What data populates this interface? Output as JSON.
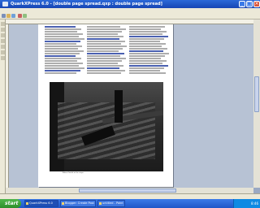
{
  "window": {
    "title": "QuarkXPress 6.0 - [double page spread.qxp : double page spread]"
  },
  "page": {
    "body_text_color": "#4a4a4a",
    "question_text_color": "#1e3a9e",
    "caption": "Robert Smith at the steps"
  },
  "taskbar": {
    "start_label": "start",
    "items": [
      {
        "label": "QuarkXPress 6.0"
      },
      {
        "label": "Blogger: Create Post"
      },
      {
        "label": "untitled - Paint"
      }
    ],
    "clock": "8:46"
  },
  "icons": [
    "app-icon",
    "minimize-icon",
    "maximize-icon",
    "close-icon",
    "start-icon"
  ]
}
